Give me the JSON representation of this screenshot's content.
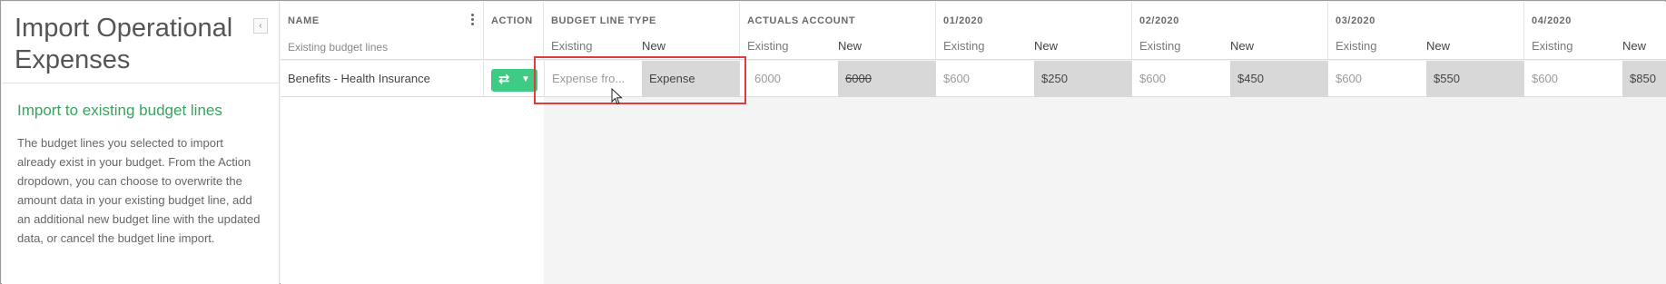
{
  "panel": {
    "title": "Import Operational Expenses",
    "collapse_glyph": "‹",
    "section_heading": "Import to existing budget lines",
    "description": "The budget lines you selected to import already exist in your budget. From the Action dropdown, you can choose to overwrite the amount data in your existing budget line, add an additional new budget line with the updated data, or cancel the budget line import."
  },
  "table": {
    "columns": {
      "name": {
        "title": "NAME",
        "subtitle": "Existing budget lines"
      },
      "action": {
        "title": "ACTION"
      },
      "budget_line_type": {
        "title": "BUDGET LINE TYPE",
        "existing": "Existing",
        "new": "New"
      },
      "actuals_account": {
        "title": "ACTUALS ACCOUNT",
        "existing": "Existing",
        "new": "New"
      },
      "m1": {
        "title": "01/2020",
        "existing": "Existing",
        "new": "New"
      },
      "m2": {
        "title": "02/2020",
        "existing": "Existing",
        "new": "New"
      },
      "m3": {
        "title": "03/2020",
        "existing": "Existing",
        "new": "New"
      },
      "m4": {
        "title": "04/2020",
        "existing": "Existing",
        "new": "New"
      }
    },
    "row": {
      "name": "Benefits - Health Insurance",
      "action_icon": "swap-arrows-icon",
      "budget_line_type": {
        "existing": "Expense fro...",
        "new": "Expense"
      },
      "actuals_account": {
        "existing": "6000",
        "new": "6000"
      },
      "m1": {
        "existing": "$600",
        "new": "$250"
      },
      "m2": {
        "existing": "$600",
        "new": "$450"
      },
      "m3": {
        "existing": "$600",
        "new": "$550"
      },
      "m4": {
        "existing": "$600",
        "new": "$850"
      }
    }
  },
  "colors": {
    "accent_green": "#3aa25f",
    "action_button": "#3ecb83",
    "highlight_border": "#e23b3b"
  }
}
